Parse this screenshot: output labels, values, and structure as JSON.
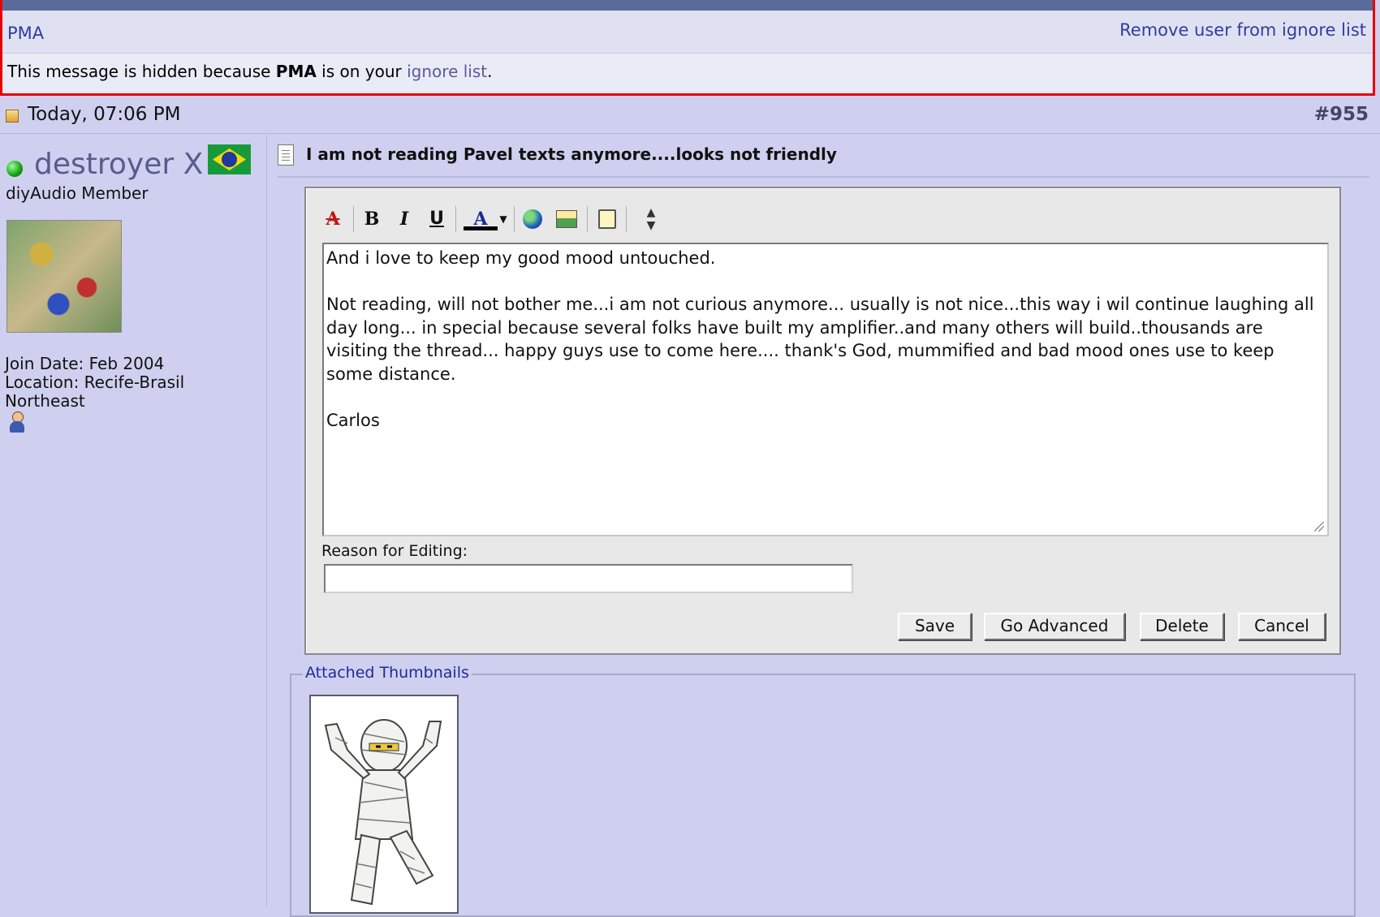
{
  "ignored_post": {
    "username": "PMA",
    "remove_link": "Remove user from ignore list",
    "message_prefix": "This message is hidden because ",
    "message_user": "PMA",
    "message_mid": " is on your ",
    "message_link": "ignore list",
    "message_suffix": "."
  },
  "post": {
    "date": "Today, 07:06 PM",
    "number": "#955",
    "title": "I am not reading Pavel texts anymore....looks not friendly"
  },
  "user": {
    "name": "destroyer X",
    "title": "diyAudio Member",
    "join_date": "Join Date: Feb 2004",
    "location_line1": "Location: Recife-Brasil",
    "location_line2": "Northeast"
  },
  "editor": {
    "toolbar": {
      "bold": "B",
      "italic": "I",
      "underline": "U",
      "font_color": "A",
      "remove_format": "A"
    },
    "content": "And i love to keep my good mood untouched.\n\nNot reading, will not bother me...i am not curious anymore... usually is not nice...this way i wil continue laughing all day long... in special because several folks have built my amplifier..and many others will build..thousands are visiting the thread... happy guys use to come here.... thank's God, mummified and bad mood ones use to keep some distance.\n\nCarlos",
    "reason_label": "Reason for Editing:",
    "reason_value": "",
    "buttons": {
      "save": "Save",
      "go_advanced": "Go Advanced",
      "delete": "Delete",
      "cancel": "Cancel"
    }
  },
  "attachments": {
    "legend": "Attached Thumbnails"
  },
  "colors": {
    "background": "#cfd0ef",
    "highlight_border": "#e80000",
    "link": "#2e3ea0"
  }
}
